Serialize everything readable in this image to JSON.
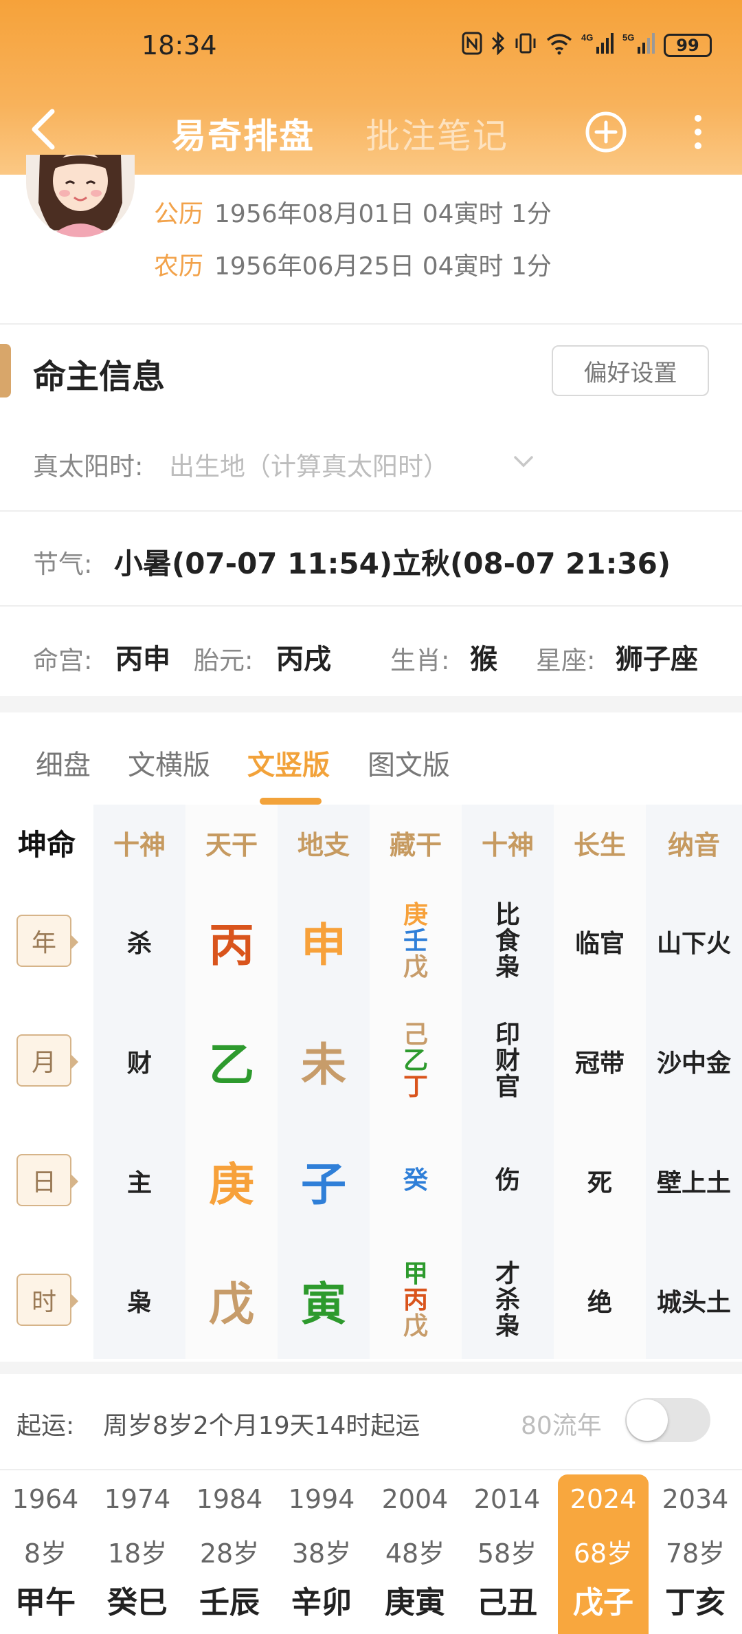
{
  "status": {
    "time": "18:34",
    "battery": "99",
    "net1": "4G",
    "net2": "5G"
  },
  "nav": {
    "title": "易奇排盘",
    "subtitle": "批注笔记"
  },
  "profile": {
    "solar_label": "公历",
    "solar_value": "1956年08月01日 04寅时 1分",
    "lunar_label": "农历",
    "lunar_value": "1956年06月25日 04寅时 1分"
  },
  "info": {
    "section_title": "命主信息",
    "pref_button": "偏好设置",
    "true_solar_label": "真太阳时:",
    "true_solar_placeholder": "出生地（计算真太阳时）",
    "jieqi_label": "节气:",
    "jieqi_value": "小暑(07-07 11:54)立秋(08-07 21:36)",
    "minggong_label": "命宫:",
    "minggong_value": "丙申",
    "taiyuan_label": "胎元:",
    "taiyuan_value": "丙戌",
    "shengxiao_label": "生肖:",
    "shengxiao_value": "猴",
    "xingzuo_label": "星座:",
    "xingzuo_value": "狮子座"
  },
  "tabs": [
    "细盘",
    "文横版",
    "文竖版",
    "图文版"
  ],
  "active_tab": "文竖版",
  "table": {
    "corner": "坤命",
    "headers": [
      "十神",
      "天干",
      "地支",
      "藏干",
      "十神",
      "长生",
      "纳音"
    ],
    "rows": [
      {
        "pillar": "年",
        "shishen": "杀",
        "tiangan": "丙",
        "dizhi": "申",
        "canggan": [
          "庚",
          "壬",
          "戊"
        ],
        "gods": [
          "比",
          "食",
          "枭"
        ],
        "changsheng": "临官",
        "nayin": "山下火"
      },
      {
        "pillar": "月",
        "shishen": "财",
        "tiangan": "乙",
        "dizhi": "未",
        "canggan": [
          "己",
          "乙",
          "丁"
        ],
        "gods": [
          "印",
          "财",
          "官"
        ],
        "changsheng": "冠带",
        "nayin": "沙中金"
      },
      {
        "pillar": "日",
        "shishen": "主",
        "tiangan": "庚",
        "dizhi": "子",
        "canggan": [
          "癸"
        ],
        "gods": [
          "伤"
        ],
        "changsheng": "死",
        "nayin": "壁上土"
      },
      {
        "pillar": "时",
        "shishen": "枭",
        "tiangan": "戊",
        "dizhi": "寅",
        "canggan": [
          "甲",
          "丙",
          "戊"
        ],
        "gods": [
          "才",
          "杀",
          "枭"
        ],
        "changsheng": "绝",
        "nayin": "城头土"
      }
    ]
  },
  "colors": {
    "accent": "#f2a23a",
    "header_text": "#c69a60",
    "fire": "#d9541c",
    "metal": "#f7a13a",
    "wood": "#2d9a2d",
    "earth": "#c79c6a",
    "water": "#2f7fd8"
  },
  "qiyun": {
    "label": "起运:",
    "value": "周岁8岁2个月19天14时起运",
    "liunian_label": "80流年",
    "toggle_on": false
  },
  "dayun": [
    {
      "year": "1964",
      "age": "8岁",
      "ganzhi": "甲午"
    },
    {
      "year": "1974",
      "age": "18岁",
      "ganzhi": "癸巳"
    },
    {
      "year": "1984",
      "age": "28岁",
      "ganzhi": "壬辰"
    },
    {
      "year": "1994",
      "age": "38岁",
      "ganzhi": "辛卯"
    },
    {
      "year": "2004",
      "age": "48岁",
      "ganzhi": "庚寅"
    },
    {
      "year": "2014",
      "age": "58岁",
      "ganzhi": "己丑"
    },
    {
      "year": "2024",
      "age": "68岁",
      "ganzhi": "戊子",
      "active": true
    },
    {
      "year": "2034",
      "age": "78岁",
      "ganzhi": "丁亥"
    }
  ]
}
